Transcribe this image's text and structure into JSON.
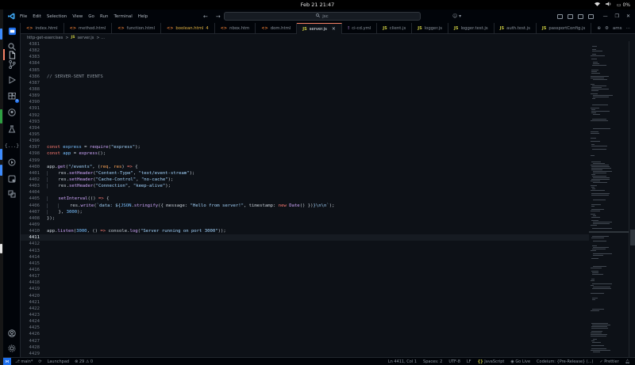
{
  "system": {
    "clock": "Feb 21  21:47",
    "battery": "0%"
  },
  "titlebar": {
    "menu": [
      "File",
      "Edit",
      "Selection",
      "View",
      "Go",
      "Run",
      "Terminal",
      "Help"
    ],
    "search": "jsc"
  },
  "tabs": [
    {
      "label": "index.html",
      "icon": "html",
      "modified": false,
      "active": false
    },
    {
      "label": "method.html",
      "icon": "html",
      "modified": false,
      "active": false
    },
    {
      "label": "function.html",
      "icon": "html",
      "modified": false,
      "active": false
    },
    {
      "label": "boolean.html",
      "icon": "html",
      "modified": true,
      "active": false,
      "badge": "4"
    },
    {
      "label": "nbox.htm",
      "icon": "html",
      "modified": false,
      "active": false
    },
    {
      "label": "dom.html",
      "icon": "html",
      "modified": false,
      "active": false
    },
    {
      "label": "server.js",
      "icon": "js",
      "modified": false,
      "active": true
    },
    {
      "label": "ci-cd.yml",
      "icon": "yml",
      "modified": false,
      "active": false
    },
    {
      "label": "client.js",
      "icon": "js",
      "modified": false,
      "active": false
    },
    {
      "label": "logger.js",
      "icon": "js",
      "modified": false,
      "active": false
    },
    {
      "label": "logger.test.js",
      "icon": "js",
      "modified": false,
      "active": false
    },
    {
      "label": "auth.test.js",
      "icon": "js",
      "modified": false,
      "active": false
    },
    {
      "label": "passportConfig.js",
      "icon": "js",
      "modified": false,
      "active": false
    }
  ],
  "tab_icon_text": {
    "html": "<>",
    "js": "JS",
    "yml": "!"
  },
  "tab_actions": [
    "⊕",
    "⚙",
    "ams",
    "⋯"
  ],
  "breadcrumb": {
    "folder": "http-get-exercises",
    "sep": ">",
    "file_icon": "JS",
    "file": "server.js",
    "trail": "> ..."
  },
  "editor": {
    "first_line": 4381,
    "current_line": 4411,
    "last_line": 4429,
    "lines": {
      "4386": [
        [
          "c",
          "// SERVER-SENT EVENTS"
        ]
      ],
      "4397": [
        [
          "k",
          "const "
        ],
        [
          "n",
          "express"
        ],
        [
          "p",
          " = "
        ],
        [
          "f",
          "require"
        ],
        [
          "p",
          "("
        ],
        [
          "s",
          "\"express\""
        ],
        [
          "p",
          ");"
        ]
      ],
      "4398": [
        [
          "k",
          "const "
        ],
        [
          "n",
          "app"
        ],
        [
          "p",
          " = "
        ],
        [
          "f",
          "express"
        ],
        [
          "p",
          "();"
        ]
      ],
      "4400": [
        [
          "p",
          "app."
        ],
        [
          "f",
          "get"
        ],
        [
          "p",
          "("
        ],
        [
          "s",
          "\"/events\""
        ],
        [
          "p",
          ", ("
        ],
        [
          "v",
          "req"
        ],
        [
          "p",
          ", "
        ],
        [
          "v",
          "res"
        ],
        [
          "p",
          ") "
        ],
        [
          "k",
          "=>"
        ],
        [
          "p",
          " {"
        ]
      ],
      "4401": [
        [
          "g",
          "    "
        ],
        [
          "p",
          "res."
        ],
        [
          "f",
          "setHeader"
        ],
        [
          "p",
          "("
        ],
        [
          "s",
          "\"Content-Type\""
        ],
        [
          "p",
          ", "
        ],
        [
          "s",
          "\"text/event-stream\""
        ],
        [
          "p",
          ");"
        ]
      ],
      "4402": [
        [
          "g",
          "    "
        ],
        [
          "p",
          "res."
        ],
        [
          "f",
          "setHeader"
        ],
        [
          "p",
          "("
        ],
        [
          "s",
          "\"Cache-Control\""
        ],
        [
          "p",
          ", "
        ],
        [
          "s",
          "\"no-cache\""
        ],
        [
          "p",
          ");"
        ]
      ],
      "4403": [
        [
          "g",
          "    "
        ],
        [
          "p",
          "res."
        ],
        [
          "f",
          "setHeader"
        ],
        [
          "p",
          "("
        ],
        [
          "s",
          "\"Connection\""
        ],
        [
          "p",
          ", "
        ],
        [
          "s",
          "\"keep-alive\""
        ],
        [
          "p",
          ");"
        ]
      ],
      "4405": [
        [
          "g",
          "    "
        ],
        [
          "f",
          "setInterval"
        ],
        [
          "p",
          "(() "
        ],
        [
          "k",
          "=>"
        ],
        [
          "p",
          " {"
        ]
      ],
      "4406": [
        [
          "g",
          "    "
        ],
        [
          "g",
          "    "
        ],
        [
          "p",
          "res."
        ],
        [
          "f",
          "write"
        ],
        [
          "p",
          "("
        ],
        [
          "s",
          "`data: ${"
        ],
        [
          "n",
          "JSON"
        ],
        [
          "p",
          "."
        ],
        [
          "f",
          "stringify"
        ],
        [
          "p",
          "({ message: "
        ],
        [
          "s",
          "\"Hello from server!\""
        ],
        [
          "p",
          ", timestamp: "
        ],
        [
          "k",
          "new "
        ],
        [
          "f",
          "Date"
        ],
        [
          "p",
          "() })"
        ],
        [
          "s",
          "}\\n\\n`"
        ],
        [
          "p",
          ");"
        ]
      ],
      "4407": [
        [
          "g",
          "    "
        ],
        [
          "p",
          "}, "
        ],
        [
          "n",
          "3000"
        ],
        [
          "p",
          ");"
        ]
      ],
      "4408": [
        [
          "p",
          "});"
        ]
      ],
      "4410": [
        [
          "p",
          "app."
        ],
        [
          "f",
          "listen"
        ],
        [
          "p",
          "("
        ],
        [
          "n",
          "3000"
        ],
        [
          "p",
          ", () "
        ],
        [
          "k",
          "=>"
        ],
        [
          "p",
          " console."
        ],
        [
          "f",
          "log"
        ],
        [
          "p",
          "("
        ],
        [
          "s",
          "\"Server running on port 3000\""
        ],
        [
          "p",
          "));"
        ]
      ]
    }
  },
  "statusbar": {
    "remote_icon": "⋈",
    "branch": "main*",
    "sync": "⟳",
    "launchpad": "Launchpad",
    "problems": "⊗ 29 ⚠ 0",
    "position": "Ln 4411, Col 1",
    "spaces": "Spaces: 2",
    "encoding": "UTF-8",
    "eol": "LF",
    "language_icon": "{}",
    "language": "JavaScript",
    "golive": "Go Live",
    "ai": "Codeium: {Pre-Release} (...)",
    "prettier": "✓ Prettier"
  },
  "colors": {
    "editor_bg": "#0d1117",
    "accent": "#1f6feb",
    "active_tab_border": "#f78166"
  }
}
